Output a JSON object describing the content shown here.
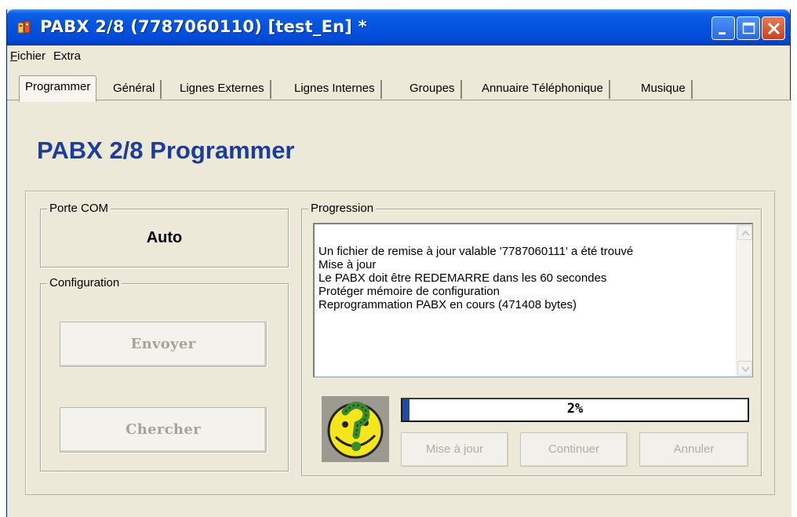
{
  "window": {
    "title": "PABX 2/8 (7787060110) [test_En] *"
  },
  "menu": [
    "Fichier",
    "Extra"
  ],
  "tabs": [
    {
      "label": "Programmer"
    },
    {
      "label": "Général"
    },
    {
      "label": "Lignes Externes"
    },
    {
      "label": "Lignes Internes"
    },
    {
      "label": "Groupes"
    },
    {
      "label": "Annuaire Téléphonique"
    },
    {
      "label": "Musique"
    }
  ],
  "heading": "PABX 2/8 Programmer",
  "com": {
    "legend": "Porte COM",
    "value": "Auto"
  },
  "configuration": {
    "legend": "Configuration",
    "send_label": "Envoyer",
    "search_label": "Chercher"
  },
  "progression": {
    "legend": "Progression",
    "log": [
      "Un fichier de remise à jour valable '7787060111' a été trouvé",
      "Mise à jour",
      "Le PABX doit être REDEMARRE dans les 60 secondes",
      "Protéger mémoire de configuration",
      "Reprogrammation PABX en cours (471408 bytes)"
    ],
    "percent": 2,
    "percent_text": "2%",
    "update_label": "Mise à jour",
    "continue_label": "Continuer",
    "cancel_label": "Annuler"
  },
  "colors": {
    "heading": "#1c3d9c",
    "progress_fill": "#1b4da8",
    "titlebar": "#0553e0"
  }
}
